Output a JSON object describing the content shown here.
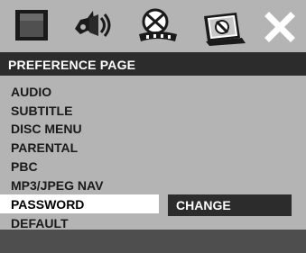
{
  "toolbar": {
    "icons": [
      {
        "name": "general-setup-icon"
      },
      {
        "name": "audio-setup-icon"
      },
      {
        "name": "dolby-digital-setup-icon"
      },
      {
        "name": "preference-page-icon",
        "active": true
      },
      {
        "name": "close-icon"
      }
    ]
  },
  "page": {
    "title": "PREFERENCE PAGE"
  },
  "menu": {
    "items": [
      {
        "label": "AUDIO"
      },
      {
        "label": "SUBTITLE"
      },
      {
        "label": "DISC MENU"
      },
      {
        "label": "PARENTAL"
      },
      {
        "label": "PBC"
      },
      {
        "label": "MP3/JPEG NAV"
      },
      {
        "label": "PASSWORD",
        "selected": true
      },
      {
        "label": "DEFAULT"
      }
    ],
    "submenu": {
      "value": "CHANGE"
    }
  },
  "colors": {
    "panel_gray": "#b4b4b4",
    "dark_bar": "#2c2c2c",
    "selection": "#ffffff",
    "text": "#1a1a1a"
  }
}
